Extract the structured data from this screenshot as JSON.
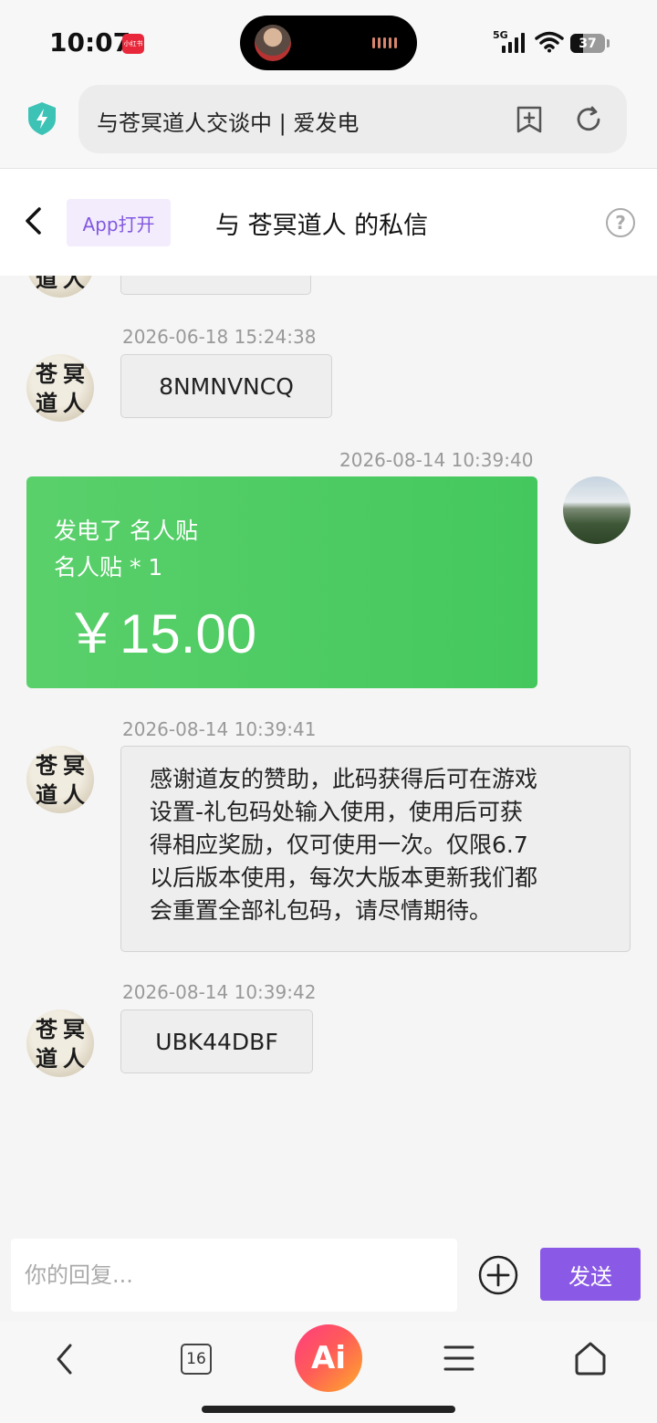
{
  "status_bar": {
    "time": "10:07",
    "app_badge": "小红书",
    "network": "5G",
    "battery": "37"
  },
  "browser": {
    "address_text": "与苍冥道人交谈中 | 爱发电",
    "tabs_count": "16",
    "ai_label": "Ai"
  },
  "header": {
    "app_open_label": "App打开",
    "title": "与 苍冥道人 的私信",
    "help_glyph": "?"
  },
  "messages": {
    "m1_time": "2026-06-18 15:24:38",
    "m1_text": "8NMNVNCQ",
    "m2_time": "2026-08-14 10:39:40",
    "gift_title": "发电了 名人贴",
    "gift_item": "名人贴 * 1",
    "gift_amount": "￥15.00",
    "m3_time": "2026-08-14 10:39:41",
    "m3_lines": [
      "感谢道友的赞助，此码获得后可在游戏",
      "设置-礼包码处输入使用，使用后可获",
      "得相应奖励，仅可使用一次。仅限6.7",
      "以后版本使用，每次大版本更新我们都",
      "会重置全部礼包码，请尽情期待。"
    ],
    "m4_time": "2026-08-14 10:39:42",
    "m4_text": "UBK44DBF"
  },
  "avatar_chars": [
    "苍",
    "冥",
    "道",
    "人"
  ],
  "reply": {
    "placeholder": "你的回复...",
    "send_label": "发送"
  },
  "colors": {
    "accent_purple": "#8a5ae6",
    "gift_green": "#4cca60",
    "shield_teal": "#3cc3b5"
  }
}
